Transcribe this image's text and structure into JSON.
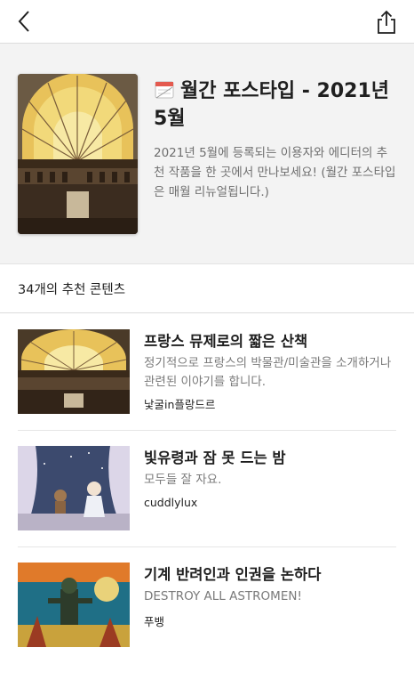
{
  "nav": {
    "back_icon": "chevron-left-icon",
    "share_icon": "share-icon"
  },
  "collection": {
    "title": "월간 포스타입 - 2021년 5월",
    "title_icon": "calendar-icon",
    "description": "2021년 5월에 등록되는 이용자와 에디터의 추천 작품을 한 곳에서 만나보세요! (월간 포스타입은 매월 리뉴얼됩니다.)"
  },
  "content_count": "34개의 추천 콘텐츠",
  "items": [
    {
      "title": "프랑스 뮤제로의 짧은 산책",
      "subtitle": "정기적으로 프랑스의 박물관/미술관을 소개하거나 관련된 이야기를 합니다.",
      "author": "낯굴in플랑드르"
    },
    {
      "title": "빛유령과 잠 못 드는 밤",
      "subtitle": "모두들 잘 자요.",
      "author": "cuddlylux"
    },
    {
      "title": "기계 반려인과 인권을 논하다",
      "subtitle": "DESTROY ALL ASTROMEN!",
      "author": "푸뱅"
    }
  ],
  "colors": {
    "header_bg": "#f3f3f3",
    "divider": "#dcdcdc",
    "muted_text": "#7a7a7a"
  }
}
